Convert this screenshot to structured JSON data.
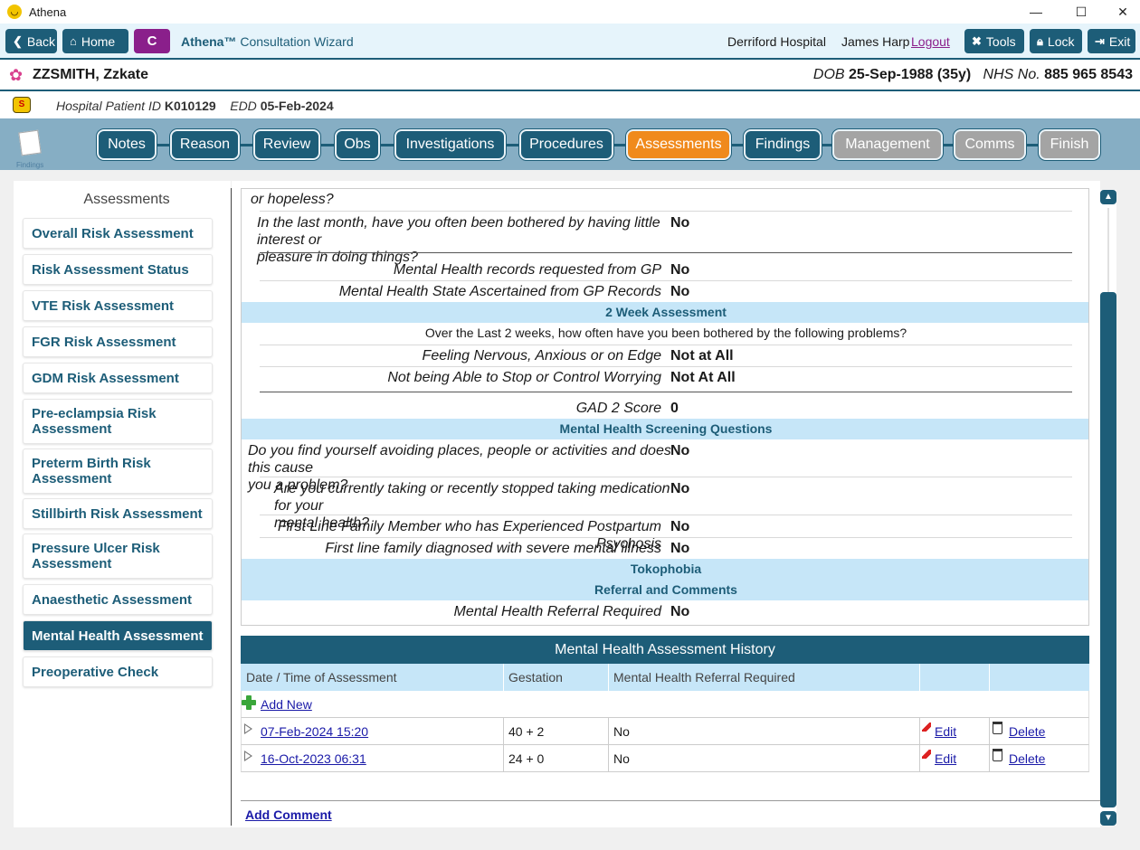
{
  "window": {
    "title": "Athena",
    "icon": "athena-smiley-icon"
  },
  "toolbar": {
    "back_label": "Back",
    "home_label": "Home",
    "c_label": "C",
    "wizard_brand": "Athena™",
    "wizard_title": "Consultation Wizard",
    "hospital": "Derriford Hospital",
    "user": "James Harp",
    "logout_label": "Logout",
    "tools_label": "Tools",
    "lock_label": "Lock",
    "exit_label": "Exit"
  },
  "patient": {
    "name": "ZZSMITH, Zzkate",
    "dob_label": "DOB",
    "dob_value": "25-Sep-1988 (35y)",
    "nhs_label": "NHS No.",
    "nhs_value": "885 965 8543",
    "hospital_id_label": "Hospital Patient ID",
    "hospital_id_value": "K010129",
    "edd_label": "EDD",
    "edd_value": "05-Feb-2024"
  },
  "nav": {
    "icon_caption": "Findings",
    "tabs": [
      {
        "label": "Notes",
        "state": "normal"
      },
      {
        "label": "Reason",
        "state": "normal"
      },
      {
        "label": "Review",
        "state": "normal"
      },
      {
        "label": "Obs",
        "state": "normal"
      },
      {
        "label": "Investigations",
        "state": "normal"
      },
      {
        "label": "Procedures",
        "state": "normal"
      },
      {
        "label": "Assessments",
        "state": "active"
      },
      {
        "label": "Findings",
        "state": "normal"
      },
      {
        "label": "Management",
        "state": "disabled"
      },
      {
        "label": "Comms",
        "state": "disabled"
      },
      {
        "label": "Finish",
        "state": "disabled"
      }
    ]
  },
  "sidebar": {
    "title": "Assessments",
    "items": [
      {
        "label": "Overall Risk Assessment"
      },
      {
        "label": "Risk Assessment Status"
      },
      {
        "label": "VTE Risk Assessment"
      },
      {
        "label": "FGR Risk Assessment"
      },
      {
        "label": "GDM Risk Assessment"
      },
      {
        "label": "Pre-eclampsia Risk Assessment"
      },
      {
        "label": "Preterm Birth Risk Assessment"
      },
      {
        "label": "Stillbirth Risk Assessment"
      },
      {
        "label": "Pressure Ulcer Risk Assessment"
      },
      {
        "label": "Anaesthetic Assessment"
      },
      {
        "label": "Mental Health Assessment",
        "active": true
      },
      {
        "label": "Preoperative Check"
      }
    ]
  },
  "questions": {
    "partial_top": "or hopeless?",
    "q_interest": "In the last month, have you often been bothered by having little interest or pleasure in doing things?",
    "q_interest_line1": "In the last month, have you often been bothered by having little interest or",
    "q_interest_line2": "pleasure in doing things?",
    "q_interest_value": "No",
    "gp_requested_label": "Mental Health records requested from GP",
    "gp_requested_value": "No",
    "gp_state_label": "Mental Health State Ascertained from GP Records",
    "gp_state_value": "No",
    "section_2week": "2 Week Assessment",
    "intro_2week": "Over the Last 2 weeks, how often have you been bothered by the following problems?",
    "nervous_label": "Feeling Nervous, Anxious or on Edge",
    "nervous_value": "Not at All",
    "worry_label": "Not being Able to Stop or Control Worrying",
    "worry_value": "Not At All",
    "gad_label": "GAD 2 Score",
    "gad_value": "0",
    "section_screening": "Mental Health Screening Questions",
    "avoid_line1": "Do you find yourself avoiding places, people or activities and does this cause",
    "avoid_line2": "you a problem?",
    "avoid_value": "No",
    "med_line1": "Are you currently taking or recently stopped taking medication for your",
    "med_line2": "mental health?",
    "med_value": "No",
    "psychosis_label": "First Line Family Member who has Experienced Postpartum Psychosis",
    "psychosis_value": "No",
    "severe_label": "First line family diagnosed with severe mental illness",
    "severe_value": "No",
    "section_tokophobia": "Tokophobia",
    "section_referral": "Referral and Comments",
    "referral_label": "Mental Health Referral Required",
    "referral_value": "No"
  },
  "history": {
    "title": "Mental Health Assessment History",
    "columns": [
      "Date / Time of Assessment",
      "Gestation",
      "Mental Health Referral Required"
    ],
    "add_new_label": "Add New",
    "rows": [
      {
        "date": "07-Feb-2024 15:20",
        "gestation": "40 + 2",
        "referral": "No",
        "edit": "Edit",
        "delete": "Delete"
      },
      {
        "date": "16-Oct-2023 06:31",
        "gestation": "24 + 0",
        "referral": "No",
        "edit": "Edit",
        "delete": "Delete"
      }
    ]
  },
  "add_comment_label": "Add Comment",
  "colors": {
    "primary": "#1d5d78",
    "active_tab": "#f08a1c",
    "disabled_tab": "#a4a4a4",
    "section_bg": "#c6e6f8",
    "c_button": "#8a1f8b"
  }
}
